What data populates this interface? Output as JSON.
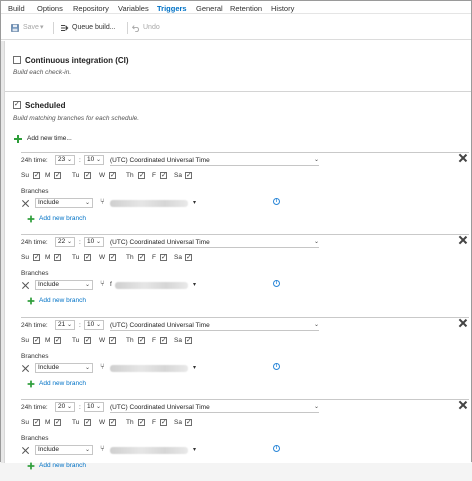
{
  "tabs": [
    {
      "label": "Build"
    },
    {
      "label": "Options"
    },
    {
      "label": "Repository"
    },
    {
      "label": "Variables"
    },
    {
      "label": "Triggers",
      "active": true
    },
    {
      "label": "General"
    },
    {
      "label": "Retention"
    },
    {
      "label": "History"
    }
  ],
  "toolbar": {
    "save_label": "Save",
    "queue_label": "Queue build...",
    "undo_label": "Undo"
  },
  "ci": {
    "title": "Continuous integration (CI)",
    "subtitle": "Build each check-in.",
    "checked": false
  },
  "scheduled": {
    "title": "Scheduled",
    "subtitle": "Build matching branches for each schedule.",
    "checked": true,
    "add_time_label": "Add new time...",
    "time_label": "24h time:",
    "colon": ":",
    "branches_label": "Branches",
    "include_label": "Include",
    "add_branch_label": "Add new branch",
    "branch_partial": "f",
    "days": [
      {
        "label": "Su"
      },
      {
        "label": "M"
      },
      {
        "label": "Tu"
      },
      {
        "label": "W"
      },
      {
        "label": "Th"
      },
      {
        "label": "F"
      },
      {
        "label": "Sa"
      }
    ],
    "schedules": [
      {
        "hour": "23",
        "minute": "10",
        "timezone": "(UTC) Coordinated Universal Time"
      },
      {
        "hour": "22",
        "minute": "10",
        "timezone": "(UTC) Coordinated Universal Time"
      },
      {
        "hour": "21",
        "minute": "10",
        "timezone": "(UTC) Coordinated Universal Time"
      },
      {
        "hour": "20",
        "minute": "10",
        "timezone": "(UTC) Coordinated Universal Time"
      }
    ]
  },
  "colors": {
    "accent": "#0072c6",
    "add_icon": "#2e9e3a"
  },
  "icons": {
    "save": "floppy-icon",
    "queue": "queue-icon",
    "undo": "undo-icon",
    "branch": "branch-icon",
    "info": "info-icon"
  }
}
